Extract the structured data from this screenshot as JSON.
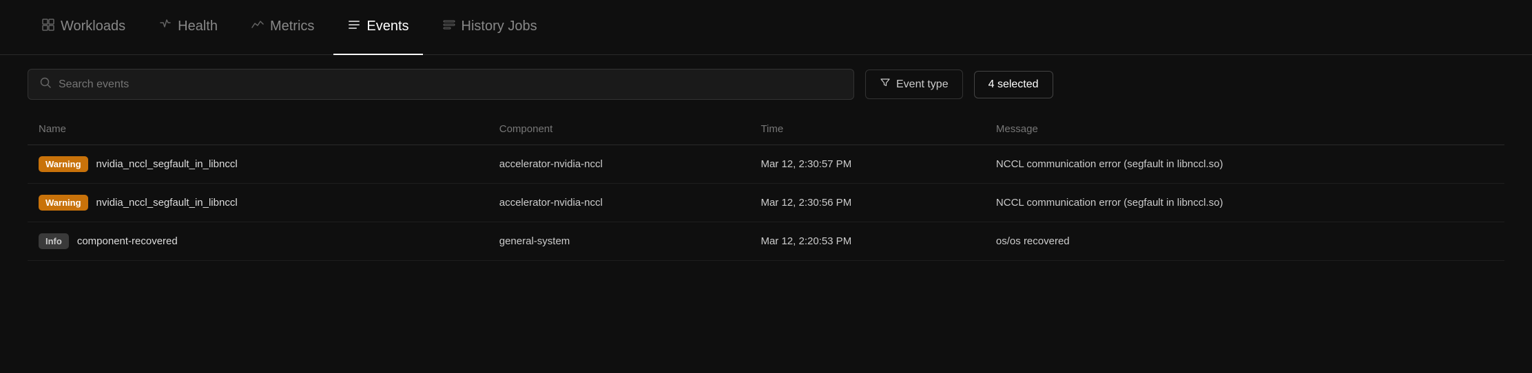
{
  "nav": {
    "items": [
      {
        "id": "workloads",
        "label": "Workloads",
        "icon": "⊞",
        "active": false
      },
      {
        "id": "health",
        "label": "Health",
        "icon": "⊟",
        "active": false
      },
      {
        "id": "metrics",
        "label": "Metrics",
        "icon": "⌇",
        "active": false
      },
      {
        "id": "events",
        "label": "Events",
        "icon": "≡",
        "active": true
      },
      {
        "id": "history-jobs",
        "label": "History Jobs",
        "icon": "≡",
        "active": false
      }
    ]
  },
  "toolbar": {
    "search_placeholder": "Search events",
    "filter_label": "Event type",
    "selected_label": "4 selected"
  },
  "table": {
    "columns": [
      "Name",
      "Component",
      "Time",
      "Message"
    ],
    "rows": [
      {
        "badge_type": "warning",
        "badge_label": "Warning",
        "name": "nvidia_nccl_segfault_in_libnccl",
        "component": "accelerator-nvidia-nccl",
        "time": "Mar 12, 2:30:57 PM",
        "message": "NCCL communication error (segfault in libnccl.so)"
      },
      {
        "badge_type": "warning",
        "badge_label": "Warning",
        "name": "nvidia_nccl_segfault_in_libnccl",
        "component": "accelerator-nvidia-nccl",
        "time": "Mar 12, 2:30:56 PM",
        "message": "NCCL communication error (segfault in libnccl.so)"
      },
      {
        "badge_type": "info",
        "badge_label": "Info",
        "name": "component-recovered",
        "component": "general-system",
        "time": "Mar 12, 2:20:53 PM",
        "message": "os/os recovered"
      }
    ]
  }
}
